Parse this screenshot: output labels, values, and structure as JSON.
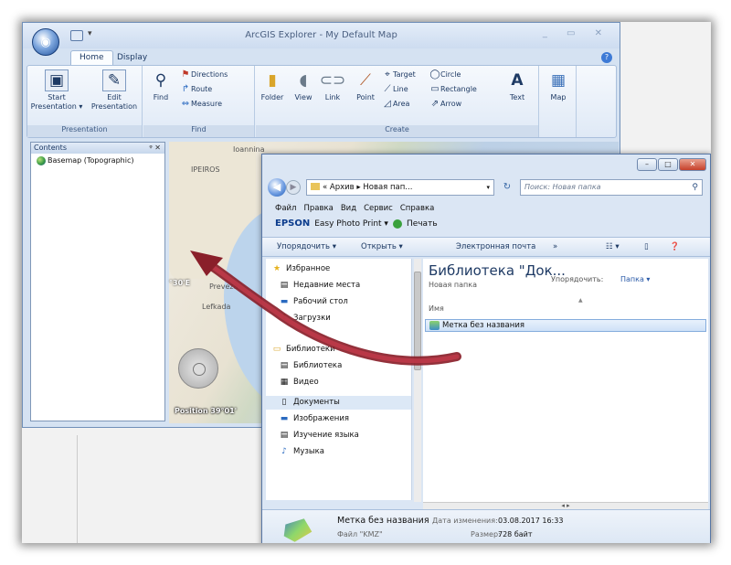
{
  "arcgis": {
    "title": "ArcGIS Explorer - My Default Map",
    "win_controls": "_ ▭ ✕",
    "tabs": [
      "Home",
      "Display"
    ],
    "groups": {
      "presentation": {
        "label": "Presentation",
        "start": "Start\nPresentation ▾",
        "edit": "Edit\nPresentation"
      },
      "find": {
        "label": "Find",
        "find": "Find",
        "directions": "Directions",
        "route": "Route",
        "measure": "Measure"
      },
      "create": {
        "label": "Create",
        "folder": "Folder",
        "view": "View",
        "link": "Link",
        "point": "Point",
        "target": "Target",
        "line": "Line",
        "area": "Area",
        "circle": "Circle",
        "rectangle": "Rectangle",
        "arrow": "Arrow",
        "text": "Text"
      },
      "map": {
        "label": "Map"
      }
    },
    "contents": {
      "title": "Contents",
      "pin": "ᵠ ✕",
      "basemap": "Basemap (Topographic)"
    },
    "map": {
      "labels": [
        "Ioannina",
        "IPEIROS",
        "Preveza",
        "Lefkada",
        "°30'E"
      ],
      "position": "Position 39°01'"
    }
  },
  "explorer": {
    "address": "« Архив ▸ Новая пап...",
    "search_placeholder": "Поиск: Новая папка",
    "menu": [
      "Файл",
      "Правка",
      "Вид",
      "Сервис",
      "Справка"
    ],
    "epson": {
      "logo": "EPSON",
      "app": "Easy Photo Print ▾",
      "print": "Печать"
    },
    "commands": {
      "organize": "Упорядочить ▾",
      "open": "Открыть ▾",
      "email": "Электронная почта",
      "more": "»"
    },
    "nav": [
      {
        "label": "Избранное",
        "icon": "★"
      },
      {
        "label": "Недавние места",
        "icon": "▤"
      },
      {
        "label": "Рабочий стол",
        "icon": "▬"
      },
      {
        "label": "Загрузки",
        "icon": "⬇"
      },
      {
        "label": "Библиотеки",
        "icon": "▭"
      },
      {
        "label": "Библиотека",
        "icon": "▤"
      },
      {
        "label": "Видео",
        "icon": "▦"
      },
      {
        "label": "Документы",
        "icon": "▯"
      },
      {
        "label": "Изображения",
        "icon": "▬"
      },
      {
        "label": "Изучение языка",
        "icon": "▤"
      },
      {
        "label": "Музыка",
        "icon": "♪"
      }
    ],
    "library": {
      "title": "Библиотека \"Док...",
      "subtitle": "Новая папка",
      "arrange_label": "Упорядочить:",
      "arrange_value": "Папка ▾",
      "column": "Имя",
      "file": "Метка без названия"
    },
    "details": {
      "name": "Метка без названия",
      "modified_label": "Дата изменения:",
      "modified_value": "03.08.2017 16:33",
      "type": "Файл \"KMZ\"",
      "size_label": "Размер:",
      "size_value": "728 байт"
    }
  }
}
